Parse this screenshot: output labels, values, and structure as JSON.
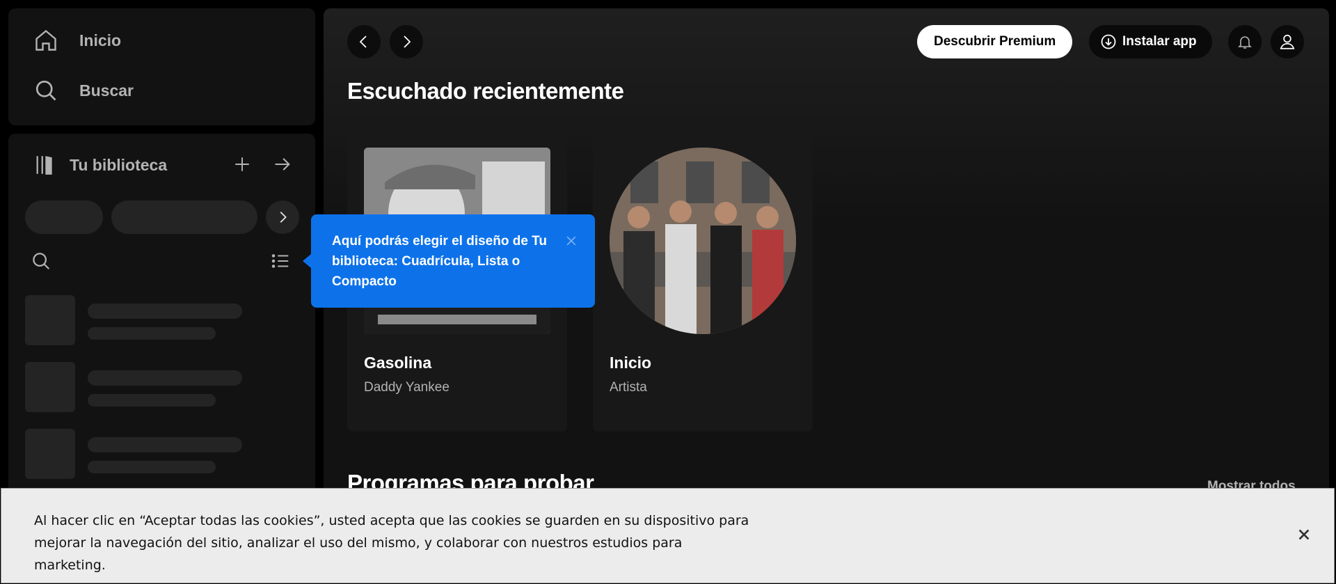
{
  "nav": {
    "home_label": "Inicio",
    "search_label": "Buscar"
  },
  "library": {
    "title": "Tu biblioteca",
    "add_icon": "plus-icon",
    "expand_icon": "arrow-right-icon",
    "skeleton_rows": 3
  },
  "header": {
    "premium_label": "Descubrir Premium",
    "install_label": "Instalar app"
  },
  "main": {
    "section_title": "Escuchado recientemente",
    "cards": [
      {
        "title": "Gasolina",
        "subtitle": "Daddy Yankee"
      },
      {
        "title": "Inicio",
        "subtitle": "Artista"
      }
    ],
    "section2_title": "Programas para probar",
    "show_all": "Mostrar todos"
  },
  "tooltip": {
    "text": "Aquí podrás elegir el diseño de Tu biblioteca: Cuadrícula, Lista o Compacto"
  },
  "cookie": {
    "text": "Al hacer clic en “Aceptar todas las cookies”, usted acepta que las cookies se guarden en su dispositivo para mejorar la navegación del sitio, analizar el uso del mismo, y colaborar con nuestros estudios para marketing."
  },
  "colors": {
    "background": "#000000",
    "panel": "#121212",
    "tooltip": "#0d72ea",
    "cookie_bg": "#ececec"
  }
}
